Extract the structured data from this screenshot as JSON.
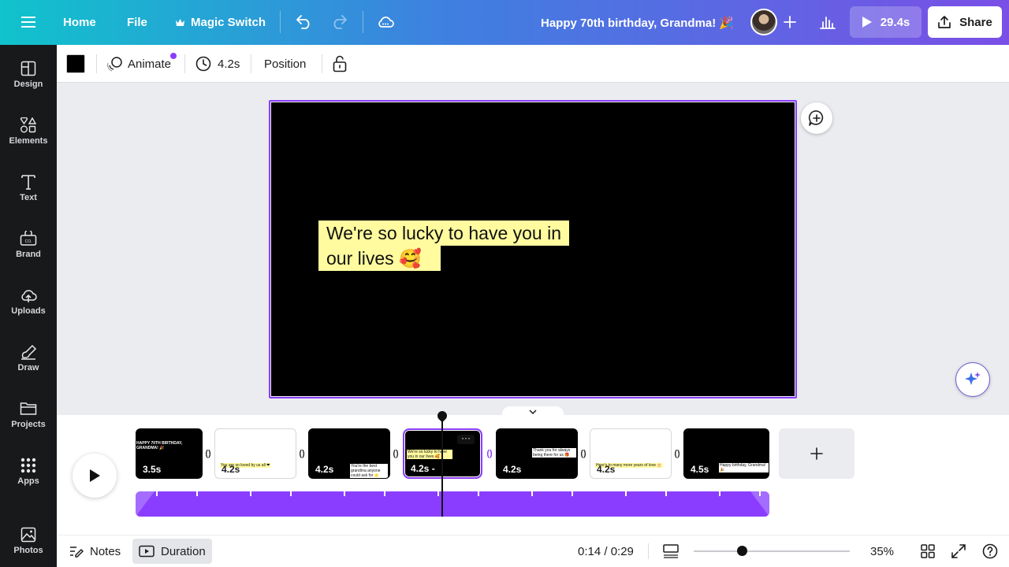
{
  "topbar": {
    "menu_icon": "hamburger-menu-icon",
    "home": "Home",
    "file": "File",
    "magic_switch": "Magic Switch",
    "title": "Happy 70th birthday, Grandma! 🎉",
    "play_duration": "29.4s",
    "share": "Share"
  },
  "sidebar": {
    "items": [
      {
        "label": "Design",
        "icon": "design-icon"
      },
      {
        "label": "Elements",
        "icon": "elements-icon"
      },
      {
        "label": "Text",
        "icon": "text-icon"
      },
      {
        "label": "Brand",
        "icon": "brand-icon"
      },
      {
        "label": "Uploads",
        "icon": "uploads-icon"
      },
      {
        "label": "Draw",
        "icon": "draw-icon"
      },
      {
        "label": "Projects",
        "icon": "projects-icon"
      },
      {
        "label": "Apps",
        "icon": "apps-icon"
      },
      {
        "label": "Photos",
        "icon": "photos-icon"
      }
    ]
  },
  "toolbar": {
    "color": "#000000",
    "animate": "Animate",
    "duration": "4.2s",
    "position": "Position"
  },
  "canvas": {
    "background": "#000000",
    "quote_line1": "We're so lucky to have you in",
    "quote_line2": "our lives 🥰"
  },
  "timeline": {
    "pages": [
      {
        "duration": "3.5s",
        "theme": "dark",
        "text": "HAPPY 70TH BIRTHDAY, GRANDMA! 🎉"
      },
      {
        "duration": "4.2s",
        "theme": "light",
        "text": "You are so loved by us all ❤"
      },
      {
        "duration": "4.2s",
        "theme": "dark",
        "text": "You're the best grandma anyone could ask for 🌟"
      },
      {
        "duration": "4.2s -",
        "theme": "dark",
        "text": "We're so lucky to have you in our lives 🥰",
        "active": true
      },
      {
        "duration": "4.2s",
        "theme": "dark",
        "text": "Thank you for always being there for us 🎁"
      },
      {
        "duration": "4.2s",
        "theme": "light",
        "text": "Here's to many more years of love 🎂"
      },
      {
        "duration": "4.5s",
        "theme": "dark",
        "text": "Happy birthday, Grandma! 🎉"
      }
    ]
  },
  "bottombar": {
    "notes": "Notes",
    "duration": "Duration",
    "time": "0:14 / 0:29",
    "zoom": "35%",
    "zoom_fraction": 0.3
  }
}
